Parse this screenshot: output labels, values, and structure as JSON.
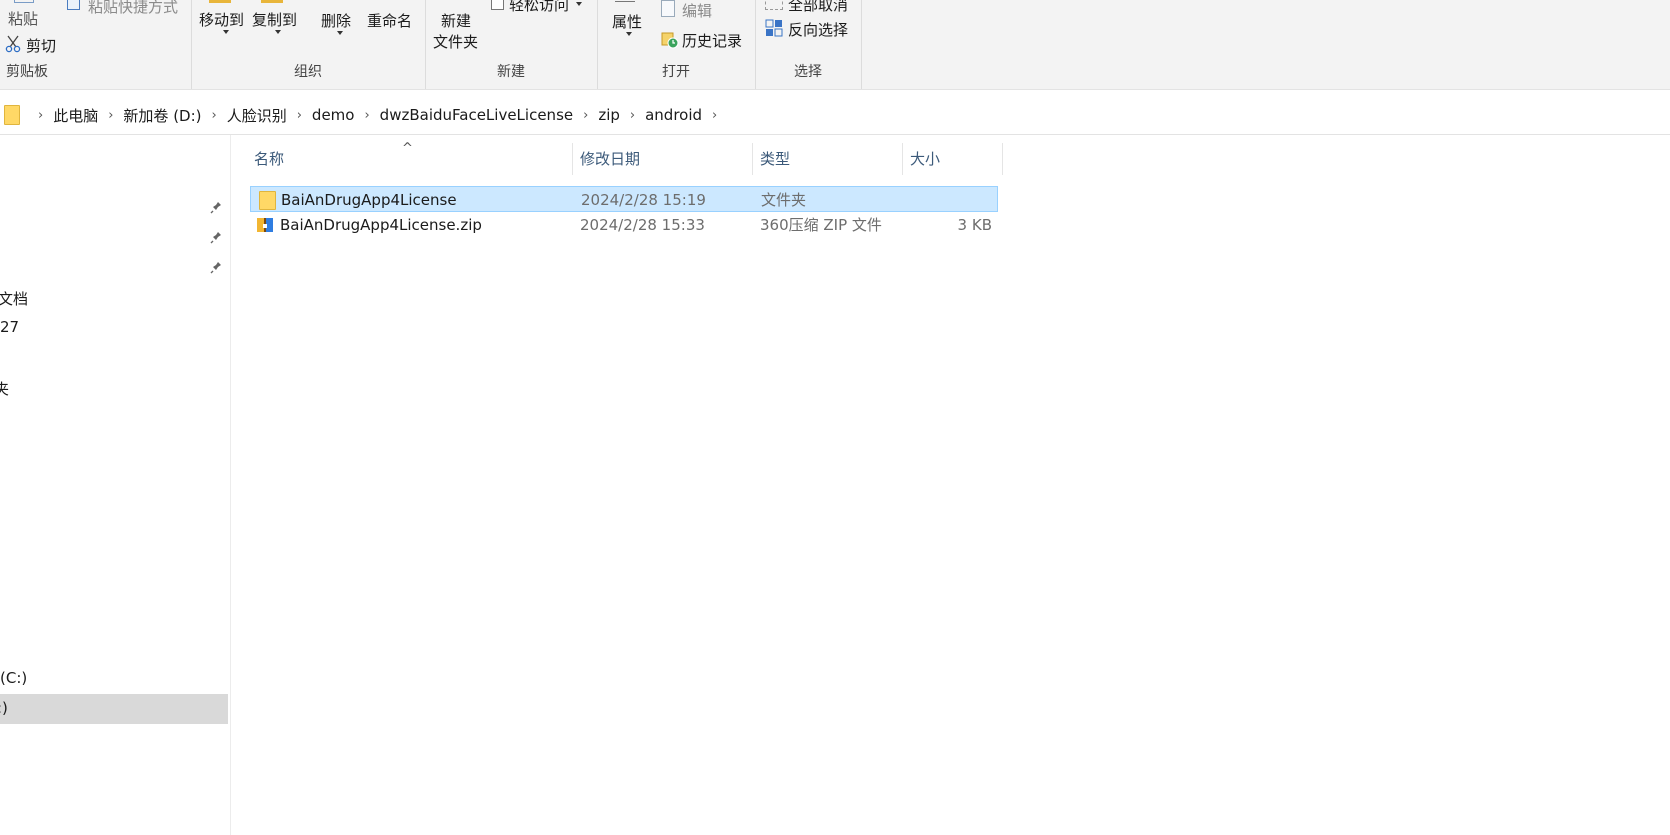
{
  "ribbon": {
    "clipboard": {
      "paste_label": "粘贴",
      "paste_shortcut_label": "粘贴快捷方式",
      "cut_label": "剪切",
      "group_label": "剪贴板"
    },
    "organize": {
      "move_to_label": "移动到",
      "copy_to_label": "复制到",
      "delete_label": "删除",
      "rename_label": "重命名",
      "group_label": "组织"
    },
    "new": {
      "new_folder_line1": "新建",
      "new_folder_line2": "文件夹",
      "easy_access_label": "轻松访问",
      "group_label": "新建"
    },
    "open": {
      "properties_label": "属性",
      "edit_label": "编辑",
      "history_label": "历史记录",
      "group_label": "打开"
    },
    "select": {
      "select_none_label": "全部取消",
      "invert_selection_label": "反向选择",
      "group_label": "选择"
    }
  },
  "address_bar": {
    "crumbs": [
      "此电脑",
      "新加卷 (D:)",
      "人脸识别",
      "demo",
      "dwzBaiduFaceLiveLicense",
      "zip",
      "android"
    ]
  },
  "nav_pane": {
    "items": [
      "文档",
      "27",
      "夹",
      "(C:)",
      ":)"
    ]
  },
  "file_list": {
    "columns": {
      "name": "名称",
      "modified": "修改日期",
      "type": "类型",
      "size": "大小"
    },
    "rows": [
      {
        "name": "BaiAnDrugApp4License",
        "modified": "2024/2/28 15:19",
        "type": "文件夹",
        "size": "",
        "icon": "folder-icon",
        "selected": true
      },
      {
        "name": "BaiAnDrugApp4License.zip",
        "modified": "2024/2/28 15:33",
        "type": "360压缩 ZIP 文件",
        "size": "3 KB",
        "icon": "zip-archive-icon",
        "selected": false
      }
    ]
  },
  "colors": {
    "selection_bg": "#cce8ff",
    "selection_border": "#99d1ff",
    "folder_yellow": "#ffd866",
    "header_text": "#3c5a7a",
    "nav_selected_bg": "#d9d9d9"
  }
}
